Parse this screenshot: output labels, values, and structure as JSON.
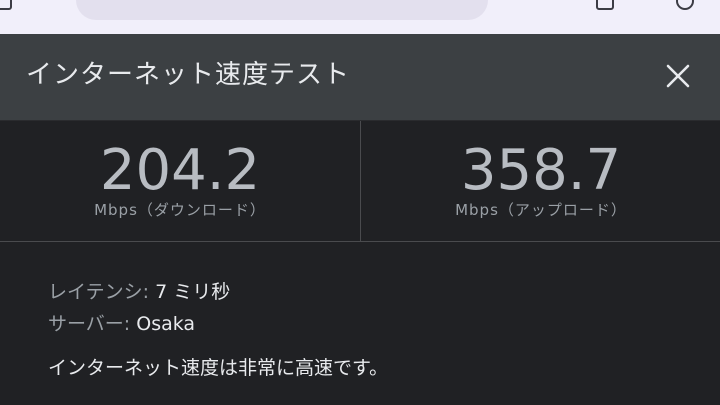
{
  "panel": {
    "title": "インターネット速度テスト"
  },
  "download": {
    "value": "204.2",
    "unit": "Mbps（ダウンロード）"
  },
  "upload": {
    "value": "358.7",
    "unit": "Mbps（アップロード）"
  },
  "details": {
    "latency_label": "レイテンシ:",
    "latency_value": " 7 ミリ秒",
    "server_label": "サーバー:",
    "server_value": " Osaka"
  },
  "summary": "インターネット速度は非常に高速です。",
  "icons": {
    "close": "close-icon"
  },
  "colors": {
    "header_bg": "#3c4043",
    "body_bg": "#202124",
    "browser_bar": "#f1effa"
  }
}
